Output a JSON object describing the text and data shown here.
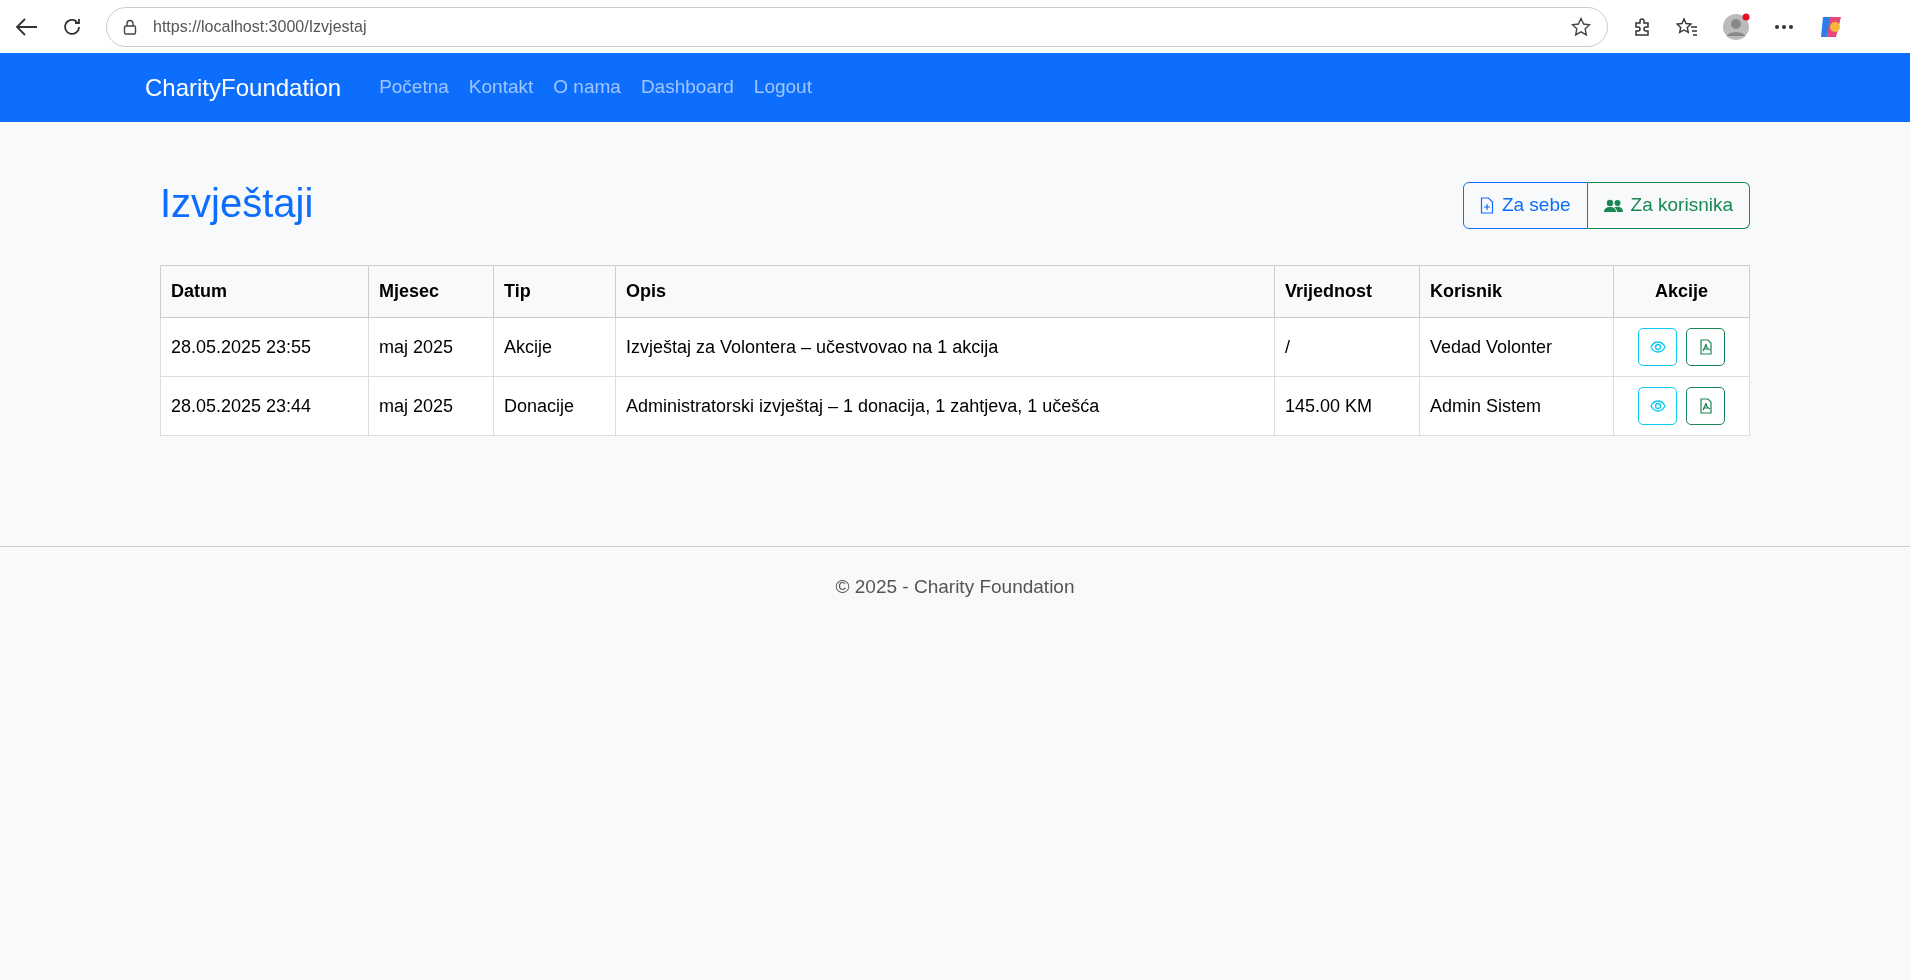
{
  "browser": {
    "url": "https://localhost:3000/Izvjestaj"
  },
  "navbar": {
    "brand": "CharityFoundation",
    "links": [
      "Početna",
      "Kontakt",
      "O nama",
      "Dashboard",
      "Logout"
    ]
  },
  "page_title": "Izvještaji",
  "buttons": [
    {
      "label": "Za sebe",
      "kind": "self"
    },
    {
      "label": "Za korisnika",
      "kind": "user"
    }
  ],
  "table": {
    "columns": [
      "Datum",
      "Mjesec",
      "Tip",
      "Opis",
      "Vrijednost",
      "Korisnik",
      "Akcije"
    ],
    "rows": [
      {
        "cells": [
          "28.05.2025 23:55",
          "maj 2025",
          "Akcije",
          "Izvještaj za Volontera – učestvovao na 1 akcija",
          "/",
          "Vedad Volonter"
        ]
      },
      {
        "cells": [
          "28.05.2025 23:44",
          "maj 2025",
          "Donacije",
          "Administratorski izvještaj – 1 donacija, 1 zahtjeva, 1 učešća",
          "145.00 KM",
          "Admin Sistem"
        ]
      }
    ]
  },
  "footer": "© 2025 - Charity Foundation"
}
